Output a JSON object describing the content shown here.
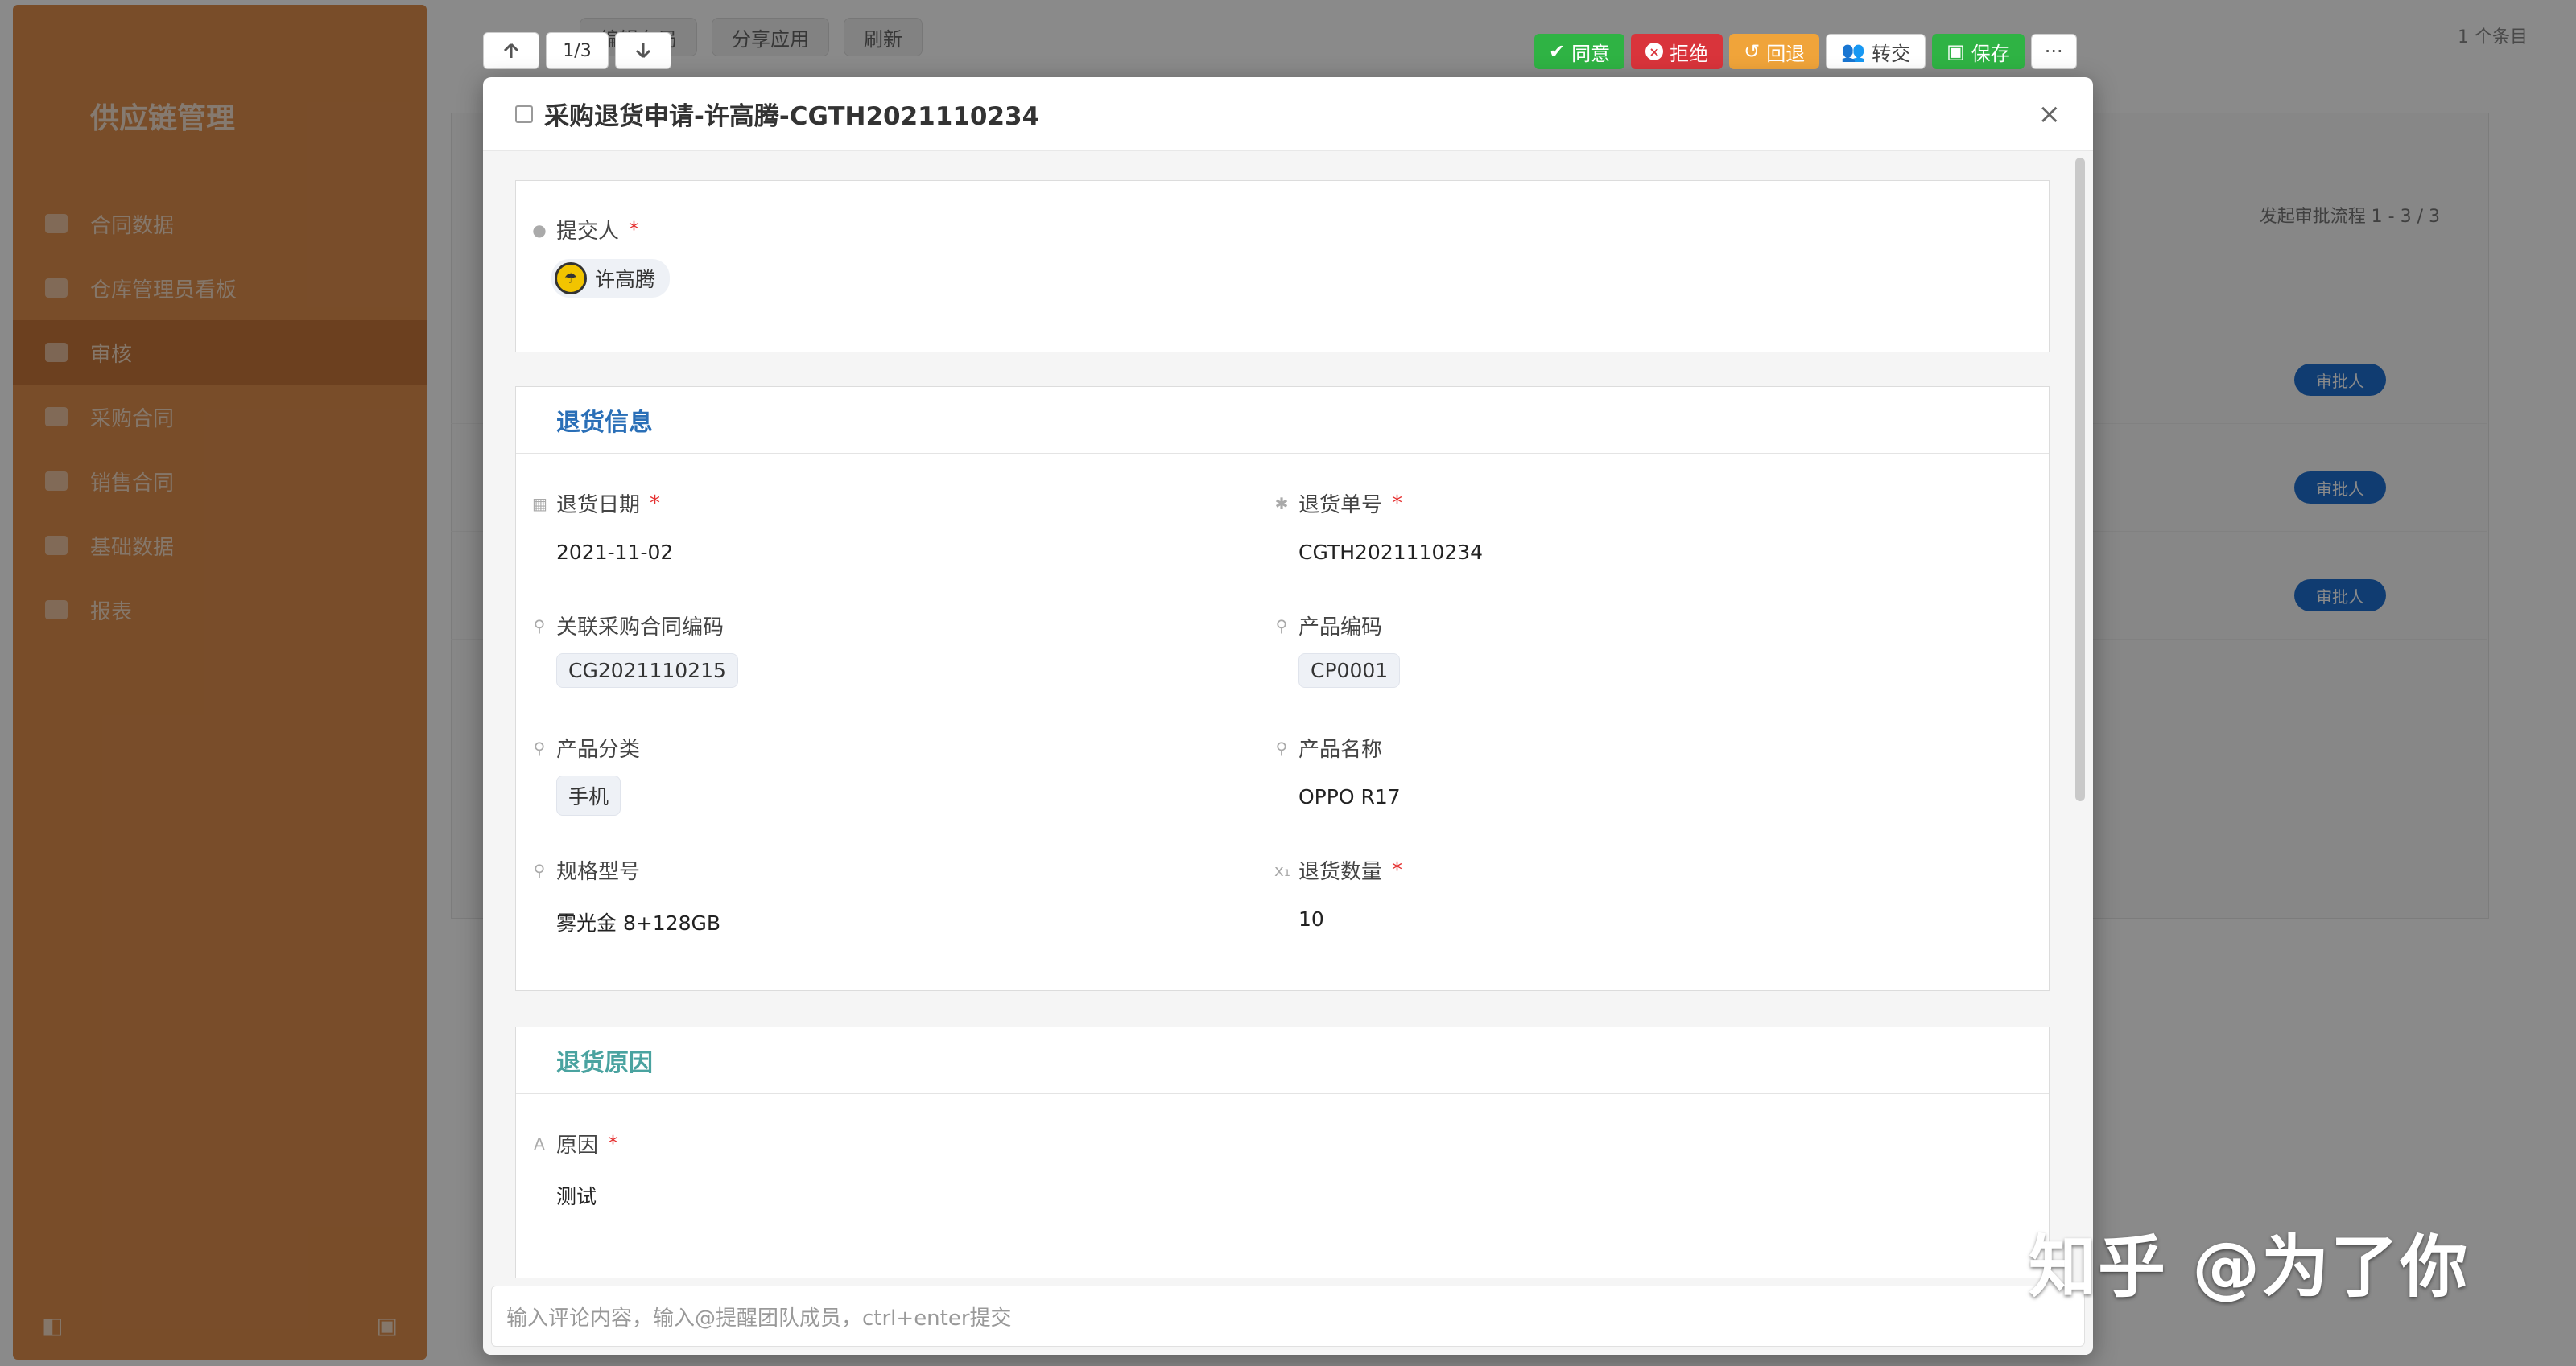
{
  "background": {
    "sidebar_brand": "供应链管理",
    "sidebar_items": [
      "合同数据",
      "仓库管理员看板",
      "审核",
      "采购合同",
      "销售合同",
      "基础数据",
      "报表"
    ],
    "toolbar_buttons": [
      "编辑布局",
      "分享应用",
      "刷新"
    ],
    "right_info": "1 个条目",
    "list_controls": "发起审批流程   1 - 3 / 3",
    "row_badges": [
      "审批人",
      "审批人",
      "审批人"
    ]
  },
  "navigator": {
    "prev_icon": "arrow-up-icon",
    "counter": "1/3",
    "next_icon": "arrow-down-icon"
  },
  "actions": {
    "approve": "同意",
    "reject": "拒绝",
    "rollback": "回退",
    "transfer": "转交",
    "save": "保存",
    "more": "···"
  },
  "modal": {
    "title": "采购退货申请-许高腾-CGTH2021110234",
    "close": "×",
    "submitter": {
      "label": "提交人",
      "required": "*",
      "name": "许高腾"
    },
    "section1": {
      "title": "退货信息",
      "fields": {
        "return_date": {
          "label": "退货日期",
          "value": "2021-11-02"
        },
        "return_no": {
          "label": "退货单号",
          "value": "CGTH2021110234"
        },
        "contract_code": {
          "label": "关联采购合同编码",
          "value": "CG2021110215"
        },
        "product_code": {
          "label": "产品编码",
          "value": "CP0001"
        },
        "category": {
          "label": "产品分类",
          "value": "手机"
        },
        "product_name": {
          "label": "产品名称",
          "value": "OPPO R17"
        },
        "spec": {
          "label": "规格型号",
          "value": "雾光金 8+128GB"
        },
        "quantity": {
          "label": "退货数量",
          "value": "10"
        }
      }
    },
    "section2": {
      "title": "退货原因",
      "reason": {
        "label": "原因",
        "value": "测试"
      }
    },
    "comment_placeholder": "输入评论内容，输入@提醒团队成员，ctrl+enter提交"
  },
  "watermark": "知乎 @为了你"
}
